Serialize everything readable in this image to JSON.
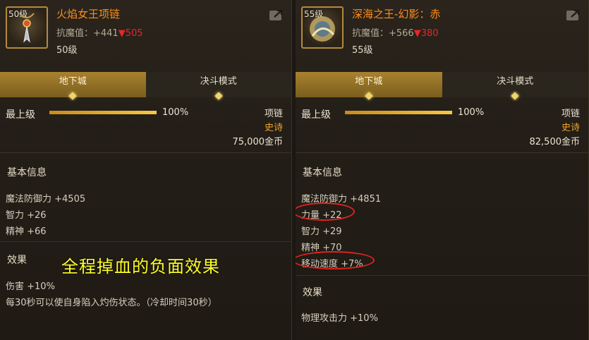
{
  "left": {
    "icon_level": "50级",
    "title": "火焰女王项链",
    "resist_label": "抗魔值：+441",
    "resist_down": "▼505",
    "level": "50级",
    "tabs": [
      "地下城",
      "决斗模式"
    ],
    "grade_label": "最上级",
    "grade_percent": "100%",
    "grade_fraction": 1.0,
    "item_type": "项链",
    "rarity": "史诗",
    "price": "75,000金币",
    "basic_info_title": "基本信息",
    "stats": [
      "魔法防御力 +4505",
      "智力 +26",
      "精神 +66"
    ],
    "effect_title": "效果",
    "effects": [
      "伤害 +10%",
      "每30秒可以使自身陷入灼伤状态。（冷却时间30秒）"
    ],
    "annotation": "全程掉血的负面效果"
  },
  "right": {
    "icon_level": "55级",
    "title": "深海之王-幻影：赤",
    "resist_label": "抗魔值：+566",
    "resist_down": "▼380",
    "level": "55级",
    "tabs": [
      "地下城",
      "决斗模式"
    ],
    "grade_label": "最上级",
    "grade_percent": "100%",
    "grade_fraction": 1.0,
    "item_type": "项链",
    "rarity": "史诗",
    "price": "82,500金币",
    "basic_info_title": "基本信息",
    "stats": [
      "魔法防御力 +4851",
      "力量 +22",
      "智力 +29",
      "精神 +70",
      "移动速度 +7%"
    ],
    "effect_title": "效果",
    "effects": [
      "物理攻击力 +10%"
    ]
  },
  "colors": {
    "title": "#ff8c1a",
    "rarity": "#f2a52a",
    "down": "#e8262b",
    "annotation": "#ffff2a",
    "circle": "#e0241f"
  },
  "icons": [
    "necklace-icon",
    "sea-king-icon",
    "share-icon"
  ]
}
